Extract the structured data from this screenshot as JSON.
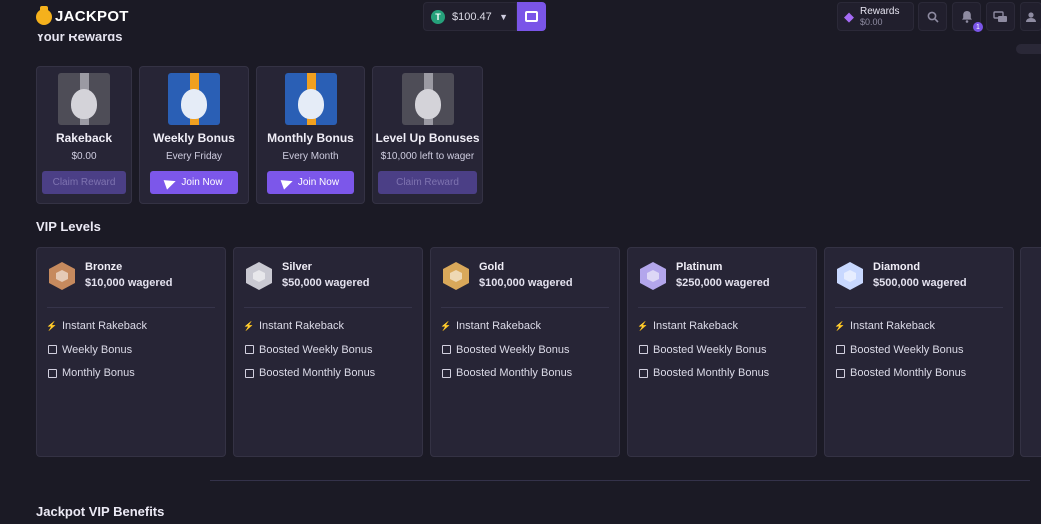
{
  "header": {
    "logo_text": "JACKPOT",
    "balance": "$100.47",
    "currency_icon": "T",
    "rewards_label": "Rewards",
    "rewards_value": "$0.00",
    "notification_count": "1"
  },
  "rewards_section": {
    "title": "Your Rewards",
    "cards": [
      {
        "title": "Rakeback",
        "subtitle": "$0.00",
        "button": "Claim Reward",
        "button_state": "disabled",
        "gift_color": "grey"
      },
      {
        "title": "Weekly Bonus",
        "subtitle": "Every Friday",
        "button": "Join Now",
        "button_state": "active",
        "gift_color": "blue"
      },
      {
        "title": "Monthly Bonus",
        "subtitle": "Every Month",
        "button": "Join Now",
        "button_state": "active",
        "gift_color": "blue"
      },
      {
        "title": "Level Up Bonuses",
        "subtitle": "$10,000 left to wager",
        "button": "Claim Reward",
        "button_state": "disabled",
        "gift_color": "grey"
      }
    ]
  },
  "vip_section": {
    "title": "VIP Levels",
    "levels": [
      {
        "name": "Bronze",
        "wager": "$10,000 wagered",
        "color": "#c68a5e",
        "features": [
          "Instant Rakeback",
          "Weekly Bonus",
          "Monthly Bonus"
        ]
      },
      {
        "name": "Silver",
        "wager": "$50,000 wagered",
        "color": "#c9c9d2",
        "features": [
          "Instant Rakeback",
          "Boosted Weekly Bonus",
          "Boosted Monthly Bonus"
        ]
      },
      {
        "name": "Gold",
        "wager": "$100,000 wagered",
        "color": "#d9a85a",
        "features": [
          "Instant Rakeback",
          "Boosted Weekly Bonus",
          "Boosted Monthly Bonus"
        ]
      },
      {
        "name": "Platinum",
        "wager": "$250,000 wagered",
        "color": "#b3a6ec",
        "features": [
          "Instant Rakeback",
          "Boosted Weekly Bonus",
          "Boosted Monthly Bonus"
        ]
      },
      {
        "name": "Diamond",
        "wager": "$500,000 wagered",
        "color": "#c8d8ff",
        "features": [
          "Instant Rakeback",
          "Boosted Weekly Bonus",
          "Boosted Monthly Bonus"
        ]
      }
    ]
  },
  "benefits_section": {
    "title": "Jackpot VIP Benefits"
  }
}
